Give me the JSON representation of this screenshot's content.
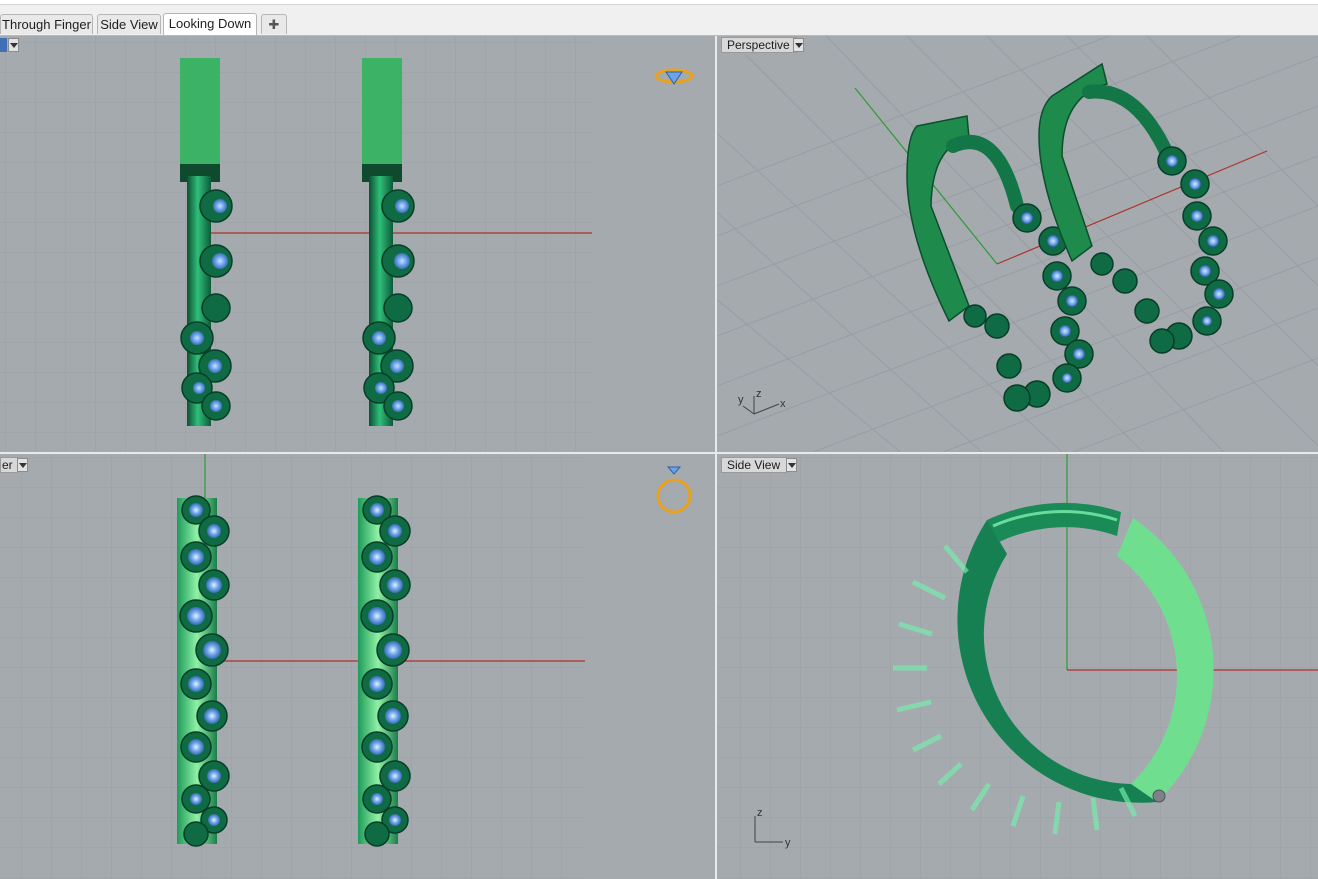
{
  "tabs": [
    {
      "label": "Through Finger",
      "active": false
    },
    {
      "label": "Side View",
      "active": false
    },
    {
      "label": "Looking Down",
      "active": true
    }
  ],
  "tab_add_icon": "plus-icon",
  "viewports": {
    "top_left": {
      "label": "",
      "object_icon": "gem-ring-icon"
    },
    "top_right": {
      "label": "Perspective",
      "axes": {
        "x": "x",
        "y": "y",
        "z": "z"
      }
    },
    "bottom_left": {
      "label": "er",
      "object_icon": "ring-icon"
    },
    "bottom_right": {
      "label": "Side View",
      "axes": {
        "z": "z",
        "y": "y"
      }
    }
  },
  "colors": {
    "viewport_bg": "#a5aaaf",
    "model_dark_green": "#157a4c",
    "model_light_green": "#6fdf8f",
    "gem_blue": "#6aa4e8",
    "axis_red": "#b0302c",
    "axis_green": "#2f9a3a",
    "ring_icon_gold": "#e9a21c"
  }
}
